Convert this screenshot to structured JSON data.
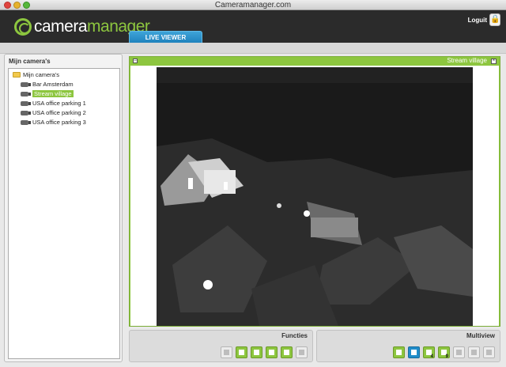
{
  "window": {
    "title": "Cameramanager.com"
  },
  "header": {
    "logo_word1": "camera",
    "logo_word2": "manager",
    "tab_live": "LIVE VIEWER",
    "logout": "Loguit"
  },
  "left_panel": {
    "title": "Mijn camera's",
    "root": "Mijn camera's",
    "cameras": [
      "Bar Amsterdam",
      "Stream village",
      "USA office parking 1",
      "USA office parking 2",
      "USA office parking 3"
    ],
    "selected": "Stream village"
  },
  "viewer": {
    "title": "Stream village"
  },
  "functions": {
    "title": "Functies",
    "buttons": [
      "microphone-icon",
      "snapshot-camera-icon",
      "edit-icon",
      "fullscreen-icon",
      "layout-icon",
      "info-icon"
    ]
  },
  "multiview": {
    "title": "Multiview",
    "buttons": [
      "1",
      "1",
      "4",
      "9",
      "1",
      "1",
      "1"
    ]
  },
  "colors": {
    "accent_green": "#8dc63f",
    "accent_blue": "#1f8cc9",
    "header_dark": "#2b2b2b"
  }
}
